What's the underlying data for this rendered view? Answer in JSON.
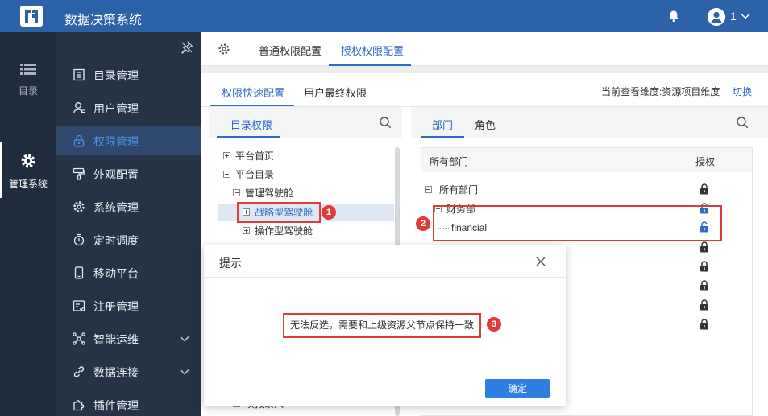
{
  "app": {
    "title": "数据决策系统",
    "username": "1"
  },
  "rail": {
    "items": [
      {
        "label": "目录"
      },
      {
        "label": "管理系统"
      }
    ]
  },
  "nav": {
    "items": [
      {
        "label": "目录管理"
      },
      {
        "label": "用户管理"
      },
      {
        "label": "权限管理"
      },
      {
        "label": "外观配置"
      },
      {
        "label": "系统管理"
      },
      {
        "label": "定时调度"
      },
      {
        "label": "移动平台"
      },
      {
        "label": "注册管理"
      },
      {
        "label": "智能运维"
      },
      {
        "label": "数据连接"
      },
      {
        "label": "插件管理"
      }
    ]
  },
  "tabs": {
    "normal": "普通权限配置",
    "grant": "授权权限配置"
  },
  "subtabs": {
    "quick": "权限快速配置",
    "final": "用户最终权限",
    "dimension": "当前查看维度:资源项目维度",
    "switch": "切换"
  },
  "catalog": {
    "title": "目录权限",
    "tree": [
      {
        "label": "平台首页"
      },
      {
        "label": "平台目录"
      },
      {
        "label": "管理驾驶舱"
      },
      {
        "label": "战略型驾驶舱"
      },
      {
        "label": "操作型驾驶舱"
      },
      {
        "label": "填报录入"
      }
    ]
  },
  "dept": {
    "tab_dept": "部门",
    "tab_role": "角色",
    "col_name": "所有部门",
    "col_auth": "授权",
    "rows": [
      {
        "label": "所有部门"
      },
      {
        "label": "财务部"
      },
      {
        "label": "financial"
      }
    ]
  },
  "badges": {
    "b1": "1",
    "b2": "2",
    "b3": "3"
  },
  "dialog": {
    "title": "提示",
    "message": "无法反选，需要和上级资源父节点保持一致",
    "ok": "确定"
  },
  "colors": {
    "topbar": "#2c63a8",
    "accent": "#2f6ac7",
    "highlight": "#e03b3b",
    "button": "#2f7fe0"
  }
}
